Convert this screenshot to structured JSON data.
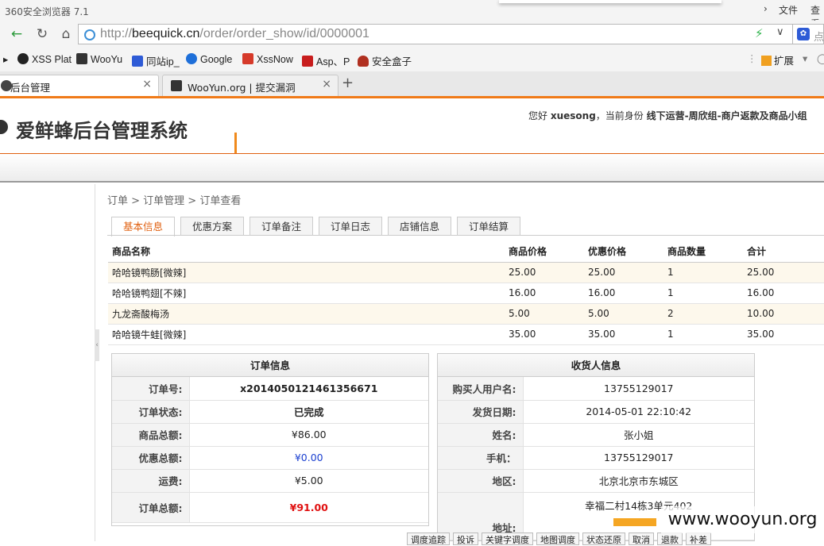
{
  "browser": {
    "title": "360安全浏览器 7.1",
    "menu_file": "文件",
    "menu_view": "查看",
    "url_prefix": "http://",
    "url_domain": "beequick.cn",
    "url_path": "/order/order_show/id/0000001",
    "search_hint": "点",
    "bookmarks": [
      {
        "label": "XSS Plat",
        "color": "#222222"
      },
      {
        "label": "WooYu",
        "color": "#333333"
      },
      {
        "label": "同站ip_",
        "color": "#2e5bd6"
      },
      {
        "label": "Google",
        "color": "#1e6fd9"
      },
      {
        "label": "XssNow",
        "color": "#d63a2a"
      },
      {
        "label": "Asp、P",
        "color": "#c81d1d"
      },
      {
        "label": "安全盒子",
        "color": "#b03020"
      }
    ],
    "extensions_label": "扩展",
    "tabs": [
      {
        "label": "后台管理",
        "close": "×"
      },
      {
        "label": "WooYun.org | 提交漏洞",
        "close": "×"
      }
    ],
    "new_tab": "+"
  },
  "header": {
    "system_title": "爱鲜蜂后台管理系统",
    "greeting": "您好",
    "username": "xuesong",
    "role_prefix": "，当前身份",
    "role": "线下运营-周欣组-商户返款及商品小组"
  },
  "breadcrumb": "订单 > 订单管理 > 订单查看",
  "order_tabs": [
    "基本信息",
    "优惠方案",
    "订单备注",
    "订单日志",
    "店铺信息",
    "订单结算"
  ],
  "items_table": {
    "headers": [
      "商品名称",
      "商品价格",
      "优惠价格",
      "商品数量",
      "合计"
    ],
    "rows": [
      [
        "哈哈镜鸭肠[微辣]",
        "25.00",
        "25.00",
        "1",
        "25.00"
      ],
      [
        "哈哈镜鸭翅[不辣]",
        "16.00",
        "16.00",
        "1",
        "16.00"
      ],
      [
        "九龙斋酸梅汤",
        "5.00",
        "5.00",
        "2",
        "10.00"
      ],
      [
        "哈哈镜牛蛙[微辣]",
        "35.00",
        "35.00",
        "1",
        "35.00"
      ]
    ]
  },
  "order_info": {
    "title": "订单信息",
    "rows": [
      {
        "key": "订单号:",
        "value": "x2014050121461356671"
      },
      {
        "key": "订单状态:",
        "value": "已完成"
      },
      {
        "key": "商品总额:",
        "value": "¥86.00"
      },
      {
        "key": "优惠总额:",
        "value": "¥0.00"
      },
      {
        "key": "运费:",
        "value": "¥5.00"
      },
      {
        "key": "订单总额:",
        "value": "¥91.00"
      }
    ]
  },
  "receiver_info": {
    "title": "收货人信息",
    "rows": [
      {
        "key": "购买人用户名:",
        "value": "13755129017"
      },
      {
        "key": "发货日期:",
        "value": "2014-05-01 22:10:42"
      },
      {
        "key": "姓名:",
        "value": "张小姐"
      },
      {
        "key": "手机：",
        "value": "13755129017"
      },
      {
        "key": "地区:",
        "value": "北京北京市东城区"
      },
      {
        "key": "地址:",
        "value": "幸福二村14栋3单元402"
      }
    ]
  },
  "bottom_actions": [
    "调度追踪",
    "投诉",
    "关键字调度",
    "地图调度",
    "状态还原",
    "取消",
    "退款",
    "补差"
  ],
  "watermark": "www.wooyun.org"
}
